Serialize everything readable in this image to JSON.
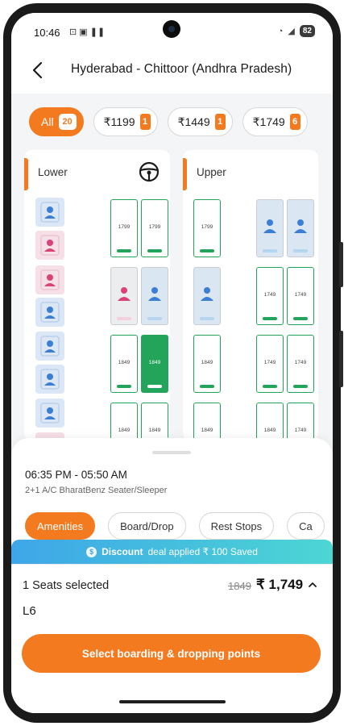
{
  "status_bar": {
    "time": "10:46",
    "battery": "82"
  },
  "header": {
    "title": "Hyderabad - Chittoor (Andhra Pradesh)"
  },
  "filters": [
    {
      "label": "All",
      "count": "20"
    },
    {
      "label": "₹1199",
      "count": "1"
    },
    {
      "label": "₹1449",
      "count": "1"
    },
    {
      "label": "₹1749",
      "count": "6"
    }
  ],
  "decks": {
    "lower": "Lower",
    "upper": "Upper"
  },
  "sleeper_prices": {
    "l1a": "1799",
    "l1b": "1799",
    "l3a": "1849",
    "l3b": "1849",
    "l4a": "1849",
    "l4b": "1849",
    "u1": "1799",
    "u2a": "1749",
    "u2b": "1749",
    "u3a": "1849",
    "u3b": "1749",
    "u3c": "1749",
    "u4a": "1849",
    "u4b": "1849",
    "u4c": "1749"
  },
  "journey": {
    "time": "06:35 PM - 05:50 AM",
    "bus_type": "2+1 A/C BharatBenz Seater/Sleeper"
  },
  "tabs": [
    "Amenities",
    "Board/Drop",
    "Rest Stops",
    "Ca"
  ],
  "discount": {
    "bold": "Discount",
    "text": "deal applied ₹ 100 Saved"
  },
  "summary": {
    "seats_selected": "1 Seats selected",
    "old_price": "1849",
    "new_price": "₹ 1,749",
    "seat_number": "L6"
  },
  "cta": {
    "label": "Select boarding & dropping points"
  },
  "colors": {
    "accent": "#f47a20",
    "available": "#22a55a",
    "male_booked": "#dbe7f6",
    "female_booked": "#f6dfe6",
    "male_icon": "#3b7fd4",
    "female_icon": "#d9437a"
  }
}
